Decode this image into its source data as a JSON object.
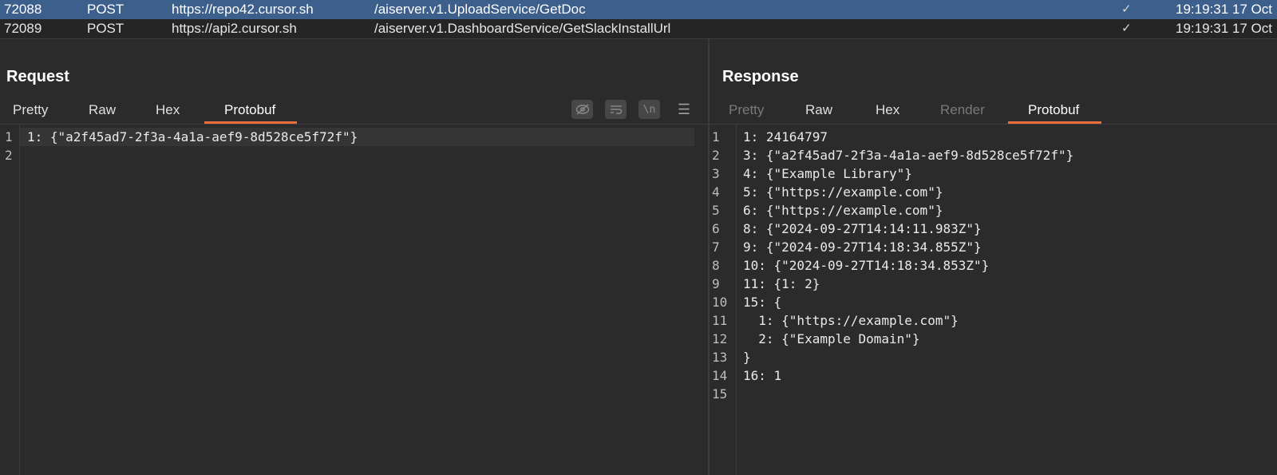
{
  "requests": [
    {
      "id": "72088",
      "method": "POST",
      "host": "https://repo42.cursor.sh",
      "path": "/aiserver.v1.UploadService/GetDoc",
      "status_icon": "✓",
      "time": "19:19:31 17 Oct"
    },
    {
      "id": "72089",
      "method": "POST",
      "host": "https://api2.cursor.sh",
      "path": "/aiserver.v1.DashboardService/GetSlackInstallUrl",
      "status_icon": "✓",
      "time": "19:19:31 17 Oct"
    }
  ],
  "request_pane": {
    "title": "Request",
    "tabs": [
      "Pretty",
      "Raw",
      "Hex",
      "Protobuf"
    ],
    "active_tab": "Protobuf",
    "tools": {
      "wrap_label": "\\n",
      "menu_label": "☰"
    },
    "line_numbers": [
      "1",
      "2"
    ],
    "lines": [
      "1: {\"a2f45ad7-2f3a-4a1a-aef9-8d528ce5f72f\"}",
      ""
    ]
  },
  "response_pane": {
    "title": "Response",
    "tabs": [
      "Pretty",
      "Raw",
      "Hex",
      "Render",
      "Protobuf"
    ],
    "active_tab": "Protobuf",
    "line_numbers": [
      "1",
      "2",
      "3",
      "4",
      "5",
      "6",
      "7",
      "8",
      "9",
      "10",
      "11",
      "12",
      "13",
      "14",
      "15"
    ],
    "lines": [
      "1: 24164797",
      "3: {\"a2f45ad7-2f3a-4a1a-aef9-8d528ce5f72f\"}",
      "4: {\"Example Library\"}",
      "5: {\"https://example.com\"}",
      "6: {\"https://example.com\"}",
      "8: {\"2024-09-27T14:14:11.983Z\"}",
      "9: {\"2024-09-27T14:18:34.855Z\"}",
      "10: {\"2024-09-27T14:18:34.853Z\"}",
      "11: {1: 2}",
      "15: {",
      "  1: {\"https://example.com\"}",
      "  2: {\"Example Domain\"}",
      "}",
      "16: 1",
      ""
    ]
  },
  "colors": {
    "accent": "#e96e3c",
    "selection": "#3d5f8c",
    "background": "#2b2b2b"
  }
}
